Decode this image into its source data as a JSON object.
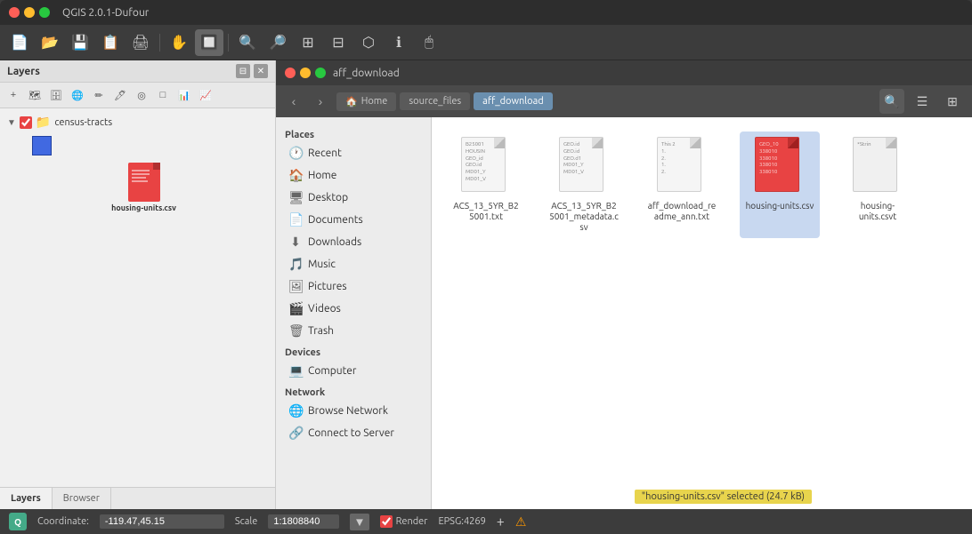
{
  "app": {
    "title": "QGIS 2.0.1-Dufour",
    "browser_title": "aff_download"
  },
  "traffic_lights": {
    "red": "#ff5f57",
    "yellow": "#febc2e",
    "green": "#28c840"
  },
  "layers_panel": {
    "title": "Layers",
    "layer_name": "census-tracts",
    "csv_label": "housing-units.csv"
  },
  "browser": {
    "breadcrumb": [
      {
        "label": "Home",
        "icon": "🏠"
      },
      {
        "label": "source_files"
      },
      {
        "label": "aff_download"
      }
    ],
    "places_title": "Places",
    "sidebar_items": [
      {
        "label": "Recent",
        "icon": "🕐"
      },
      {
        "label": "Home",
        "icon": "🏠"
      },
      {
        "label": "Desktop",
        "icon": "🖥"
      },
      {
        "label": "Documents",
        "icon": "📄"
      },
      {
        "label": "Downloads",
        "icon": "⬇"
      },
      {
        "label": "Music",
        "icon": "🎵"
      },
      {
        "label": "Pictures",
        "icon": "🖼"
      },
      {
        "label": "Videos",
        "icon": "🎬"
      },
      {
        "label": "Trash",
        "icon": "🗑"
      }
    ],
    "devices_title": "Devices",
    "devices_items": [
      {
        "label": "Computer",
        "icon": "💻"
      }
    ],
    "network_title": "Network",
    "network_items": [
      {
        "label": "Browse Network",
        "icon": "🌐"
      },
      {
        "label": "Connect to Server",
        "icon": "🔗"
      }
    ],
    "files": [
      {
        "name": "ACS_13_5YR_B25001.txt",
        "type": "txt",
        "content": "B25001\nHOUSIN\nGEO_id\nGEO.id\nMD01_Y\nMD01_V"
      },
      {
        "name": "ACS_13_5YR_B25001_metadata.csv",
        "type": "txt",
        "content": "GEO.id\nGEO.id\nGEO.d1\nMD01_Y\nMD01_V"
      },
      {
        "name": "aff_download_readme_ann.txt",
        "type": "txt",
        "content": "This 2\n1.\n2.\n1.\n2."
      },
      {
        "name": "housing-units.csv",
        "type": "csv-orange",
        "selected": true,
        "content": "GEO_10\n338010\n338010\n338010\n338010\n338010"
      },
      {
        "name": "housing-units.csvt",
        "type": "csvt",
        "content": "*Strin"
      }
    ]
  },
  "statusbar": {
    "coordinate_label": "Coordinate:",
    "coordinate_value": "-119.47,45.15",
    "scale_label": "Scale",
    "scale_value": "1:1808840",
    "epsg": "EPSG:4269",
    "render_label": "Render",
    "selected_info": "\"housing-units.csv\" selected  (24.7 kB)"
  },
  "tabs": {
    "layers_label": "Layers",
    "browser_label": "Browser"
  }
}
